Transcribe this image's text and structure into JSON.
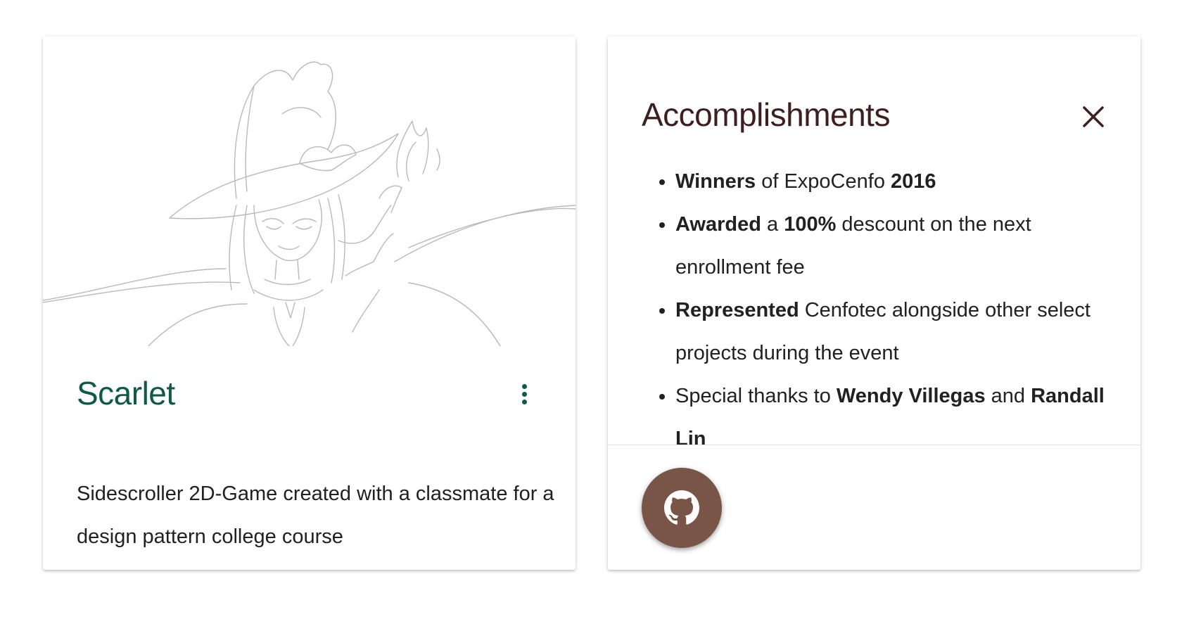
{
  "colors": {
    "title_left": "#0f5a45",
    "title_right": "#3e1f1f",
    "menu_dots": "#0f5a45",
    "close_icon": "#3e1f1f",
    "fab_background": "#795548",
    "fab_icon": "#ffffff",
    "body_text": "#212121"
  },
  "project_card": {
    "image_alt": "witch-sketch",
    "title": "Scarlet",
    "menu_icon": "more-vert-icon",
    "description": "Sidescroller 2D-Game created with a classmate for a design pattern college course"
  },
  "reveal_card": {
    "title": "Accomplishments",
    "close_icon": "close-icon",
    "items": [
      [
        {
          "text": "Winners",
          "bold": true
        },
        {
          "text": " of ExpoCenfo ",
          "bold": false
        },
        {
          "text": "2016",
          "bold": true
        }
      ],
      [
        {
          "text": "Awarded",
          "bold": true
        },
        {
          "text": " a ",
          "bold": false
        },
        {
          "text": "100%",
          "bold": true
        },
        {
          "text": " descount on the next enrollment fee",
          "bold": false
        }
      ],
      [
        {
          "text": "Represented",
          "bold": true
        },
        {
          "text": " Cenfotec alongside other select projects during the event",
          "bold": false
        }
      ],
      [
        {
          "text": "Special thanks to ",
          "bold": false
        },
        {
          "text": "Wendy Villegas",
          "bold": true
        },
        {
          "text": " and ",
          "bold": false
        },
        {
          "text": "Randall Lin",
          "bold": true
        }
      ]
    ],
    "fab_icon": "github-icon"
  }
}
